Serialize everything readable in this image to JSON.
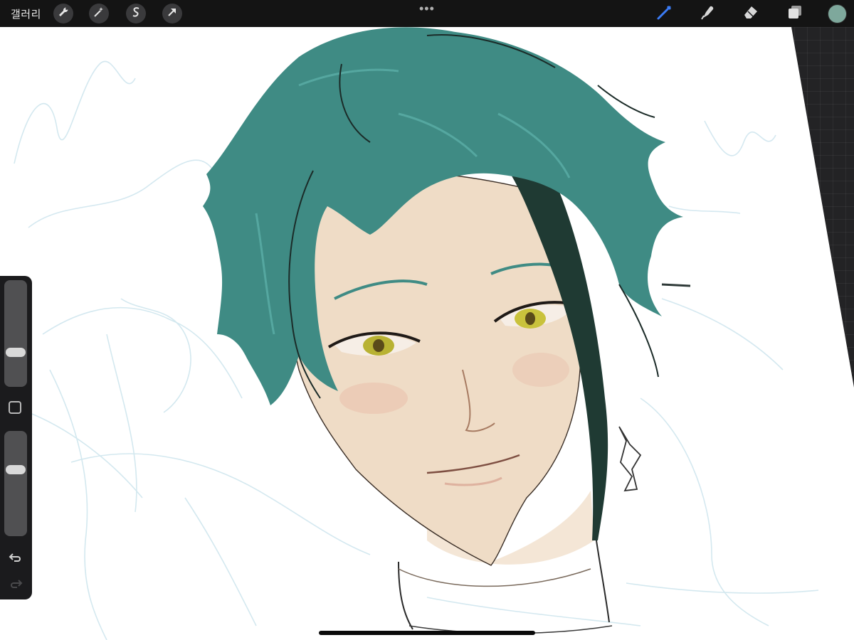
{
  "topbar": {
    "gallery_label": "갤러리",
    "more_glyph": "•••",
    "left_tools": [
      "wrench-icon",
      "magic-wand-icon",
      "selection-s-icon",
      "transform-arrow-icon"
    ],
    "right_tools": [
      "brush-icon",
      "smudge-icon",
      "eraser-icon",
      "layers-icon"
    ],
    "active_tool": "brush-icon",
    "current_color": "#7ea89c",
    "accent_color": "#3b7cf6"
  },
  "sidebar": {
    "brush_size_level": 0.3,
    "opacity_level": 0.65
  },
  "canvas": {
    "paper_color": "#ffffff",
    "hair_color": "#3f8b84",
    "skin_color": "#efdcc6",
    "eye_color": "#b8b233"
  }
}
